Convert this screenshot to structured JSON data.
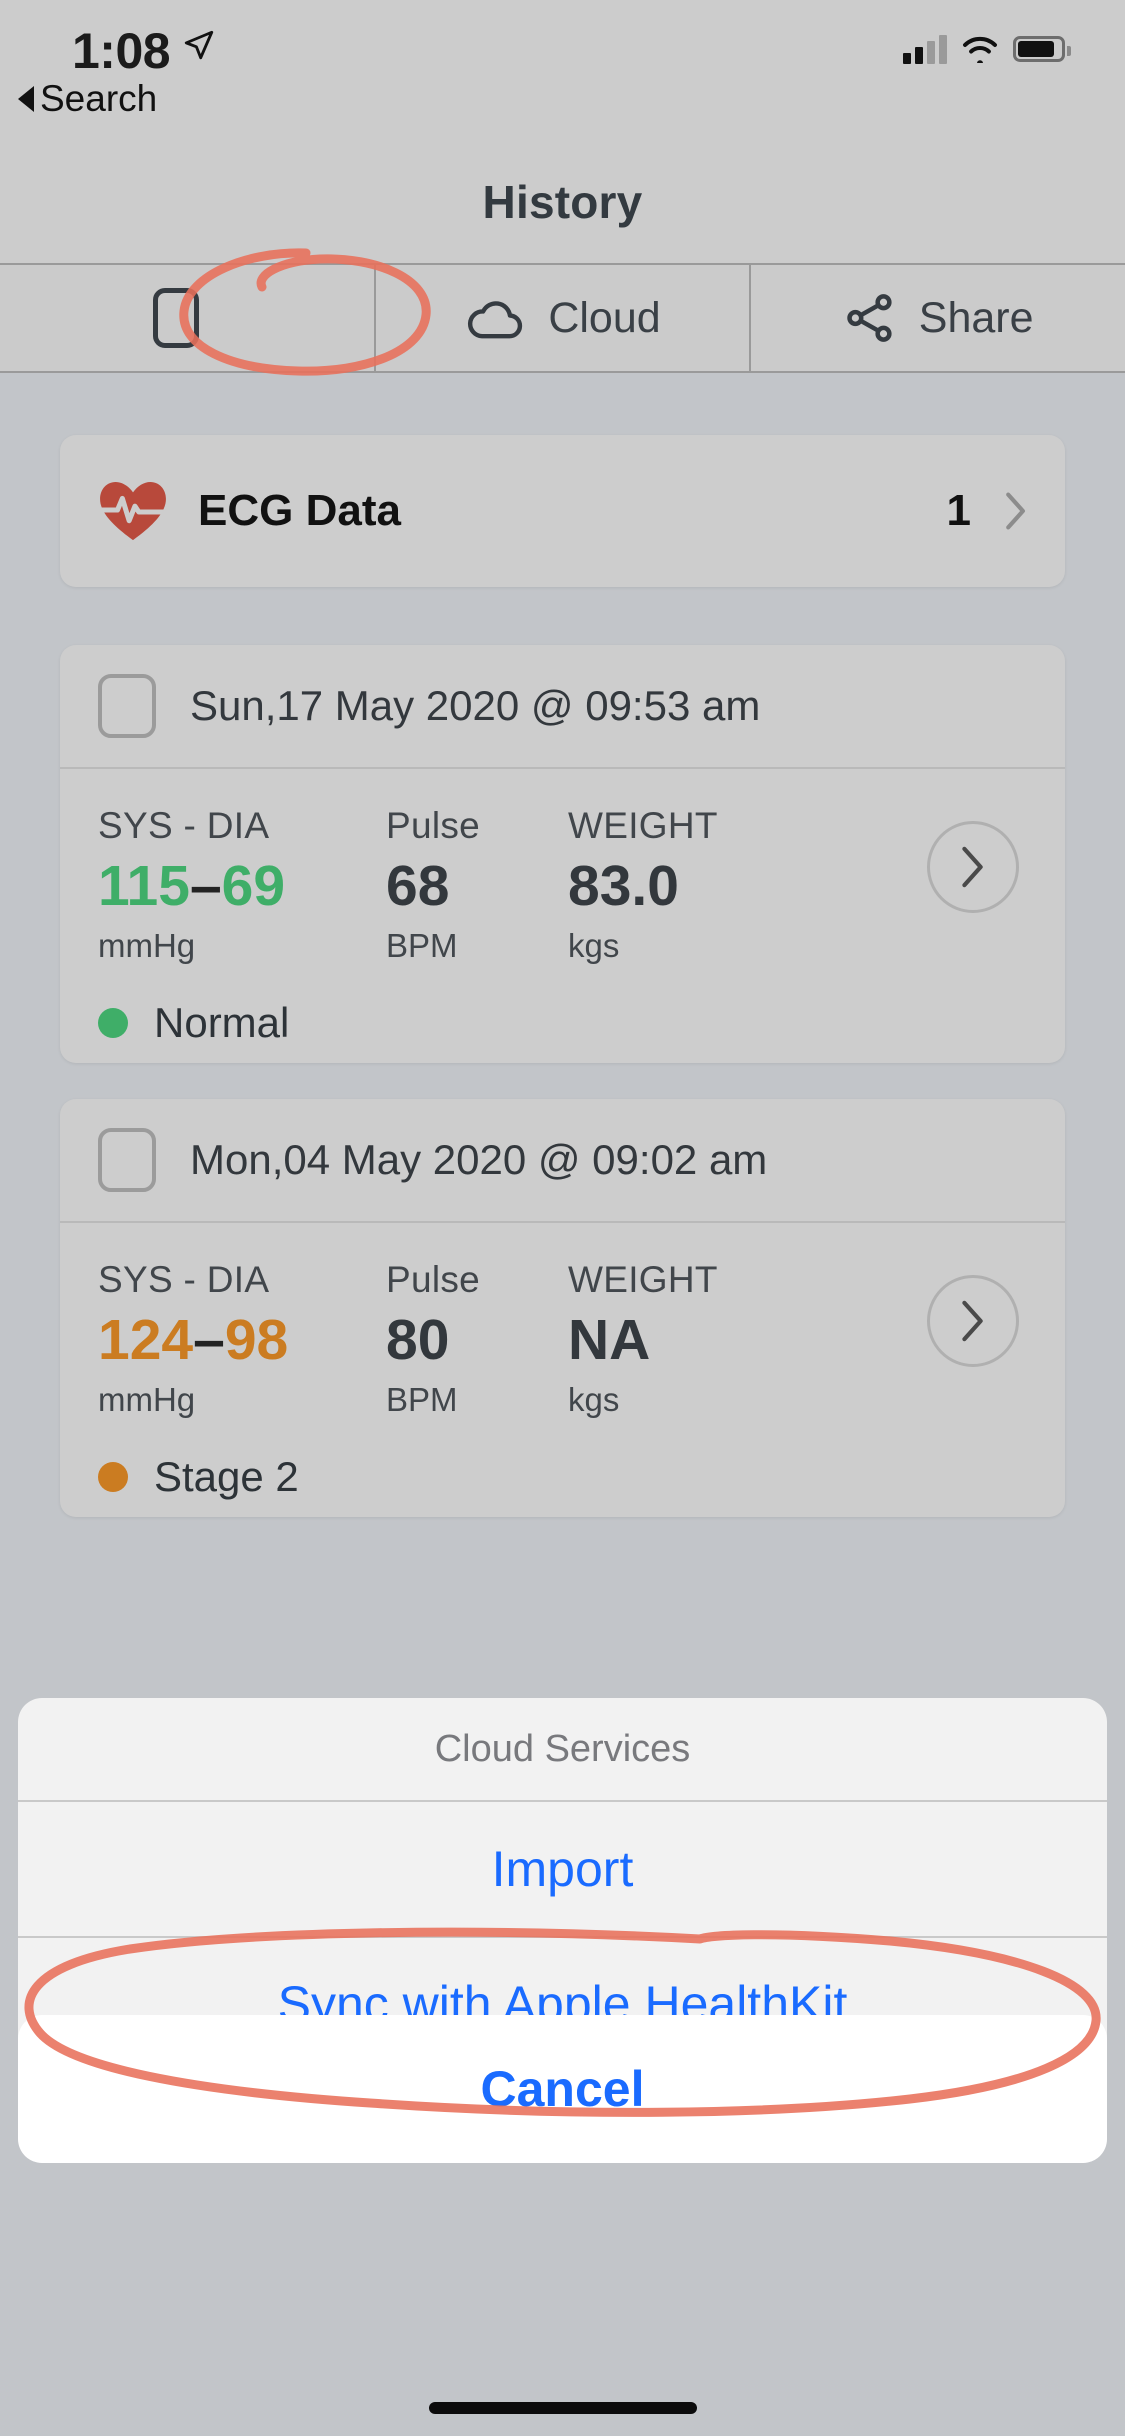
{
  "status_bar": {
    "time": "1:08",
    "location_icon": "location-arrow-icon",
    "cellular_icon": "cellular-bars-icon",
    "wifi_icon": "wifi-icon",
    "battery_icon": "battery-icon"
  },
  "back": {
    "label": "Search",
    "icon": "back-triangle-icon"
  },
  "nav": {
    "title": "History"
  },
  "toolbar": {
    "items": [
      {
        "label": "",
        "icon": "document-icon"
      },
      {
        "label": "Cloud",
        "icon": "cloud-icon"
      },
      {
        "label": "Share",
        "icon": "share-icon"
      }
    ]
  },
  "ecg": {
    "icon": "heart-pulse-icon",
    "label": "ECG Data",
    "count": "1",
    "chevron": "chevron-right-icon"
  },
  "readings": [
    {
      "date": "Sun,17 May 2020 @ 09:53 am",
      "sys_dia_title": "SYS - DIA",
      "sys": "115",
      "dash": "–",
      "dia": "69",
      "sys_dia_unit": "mmHg",
      "pulse_title": "Pulse",
      "pulse": "68",
      "pulse_unit": "BPM",
      "weight_title": "WEIGHT",
      "weight": "83.0",
      "weight_unit": "kgs",
      "status": "Normal",
      "status_color": "#3fae68",
      "value_color": "#3fae68"
    },
    {
      "date": "Mon,04 May 2020 @ 09:02 am",
      "sys_dia_title": "SYS - DIA",
      "sys": "124",
      "dash": "–",
      "dia": "98",
      "sys_dia_unit": "mmHg",
      "pulse_title": "Pulse",
      "pulse": "80",
      "pulse_unit": "BPM",
      "weight_title": "WEIGHT",
      "weight": "NA",
      "weight_unit": "kgs",
      "status": "Stage 2",
      "status_color": "#cb7c21",
      "value_color": "#cb7c21"
    }
  ],
  "action_sheet": {
    "title": "Cloud Services",
    "options": [
      {
        "label": "Import"
      },
      {
        "label": "Sync with Apple HealthKit"
      }
    ],
    "cancel_label": "Cancel",
    "tint": "#1a6bff"
  },
  "annotations": {
    "color": "#e8705a",
    "circled": [
      "Cloud",
      "Sync with Apple HealthKit"
    ]
  }
}
